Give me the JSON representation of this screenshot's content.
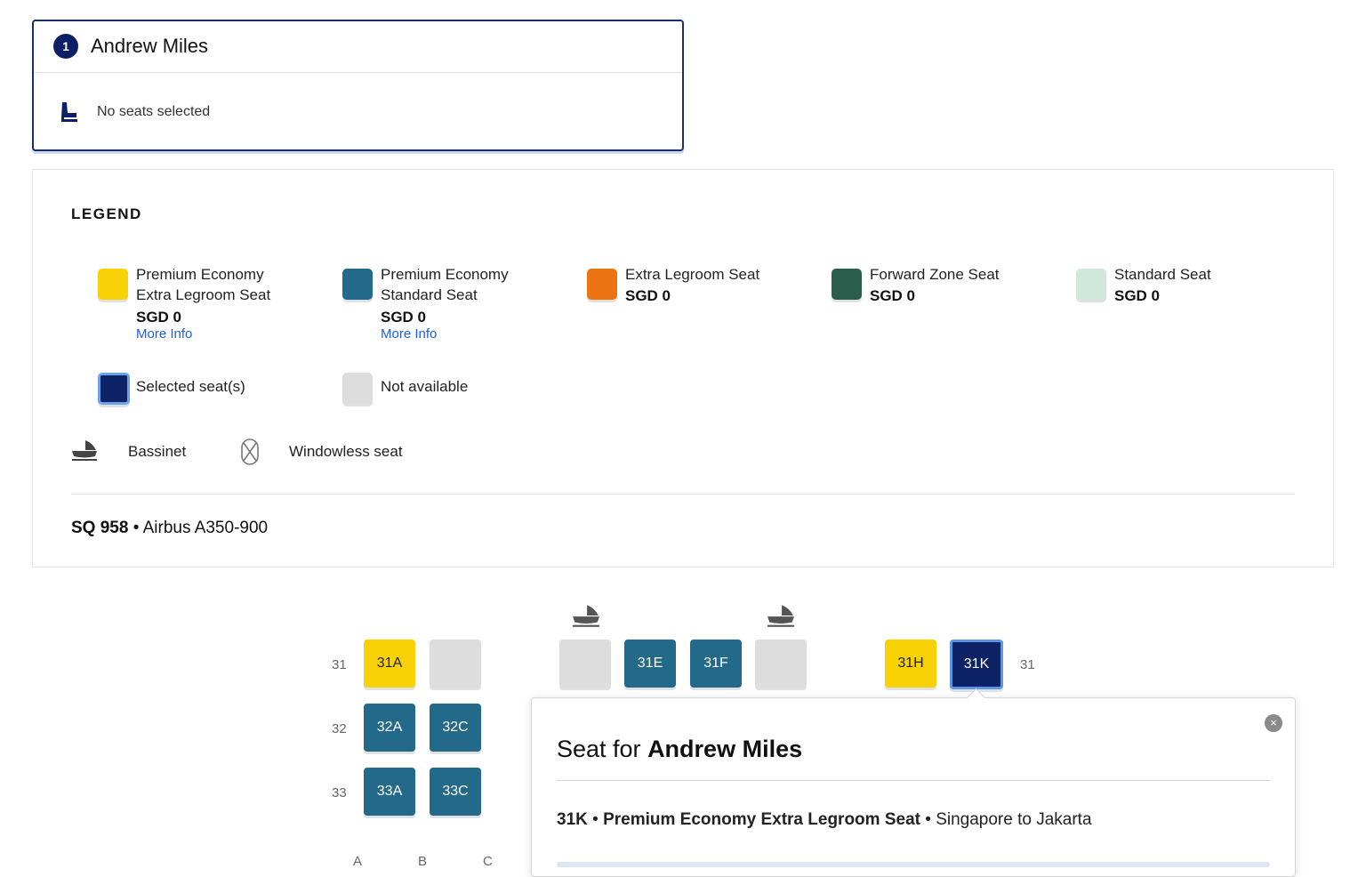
{
  "passenger": {
    "number": "1",
    "name": "Andrew Miles",
    "seat_status": "No seats selected"
  },
  "legend": {
    "title": "LEGEND",
    "items": [
      {
        "name_line1": "Premium Economy",
        "name_line2": "Extra Legroom Seat",
        "price": "SGD 0",
        "link": "More Info",
        "color": "#f8d106"
      },
      {
        "name_line1": "Premium Economy",
        "name_line2": "Standard Seat",
        "price": "SGD 0",
        "link": "More Info",
        "color": "#23698a"
      },
      {
        "name_line1": "Extra Legroom Seat",
        "price": "SGD 0",
        "color": "#ec7413"
      },
      {
        "name_line1": "Forward Zone Seat",
        "price": "SGD 0",
        "color": "#2b5e4c"
      },
      {
        "name_line1": "Standard Seat",
        "price": "SGD 0",
        "color": "#cfe8db"
      }
    ],
    "selected_label": "Selected seat(s)",
    "selected_color": "#0e2266",
    "unavailable_label": "Not available",
    "unavailable_color": "#dddddd",
    "bassinet_label": "Bassinet",
    "windowless_label": "Windowless seat"
  },
  "flight": {
    "number": "SQ 958",
    "separator": " • ",
    "aircraft": "Airbus A350-900"
  },
  "seat_map": {
    "rows": [
      "31",
      "32",
      "33"
    ],
    "right_row_label": "31",
    "columns": [
      "A",
      "B",
      "C"
    ],
    "seats": {
      "s31A": "31A",
      "s31E": "31E",
      "s31F": "31F",
      "s31H": "31H",
      "s31K": "31K",
      "s32A": "32A",
      "s32C": "32C",
      "s33A": "33A",
      "s33C": "33C"
    }
  },
  "popup": {
    "title_prefix": "Seat for ",
    "title_name": "Andrew Miles",
    "close_icon": "×",
    "seat_code": "31K",
    "dot1": " • ",
    "seat_type": "Premium Economy Extra Legroom Seat",
    "dot2": " • ",
    "route": "Singapore to Jakarta"
  }
}
